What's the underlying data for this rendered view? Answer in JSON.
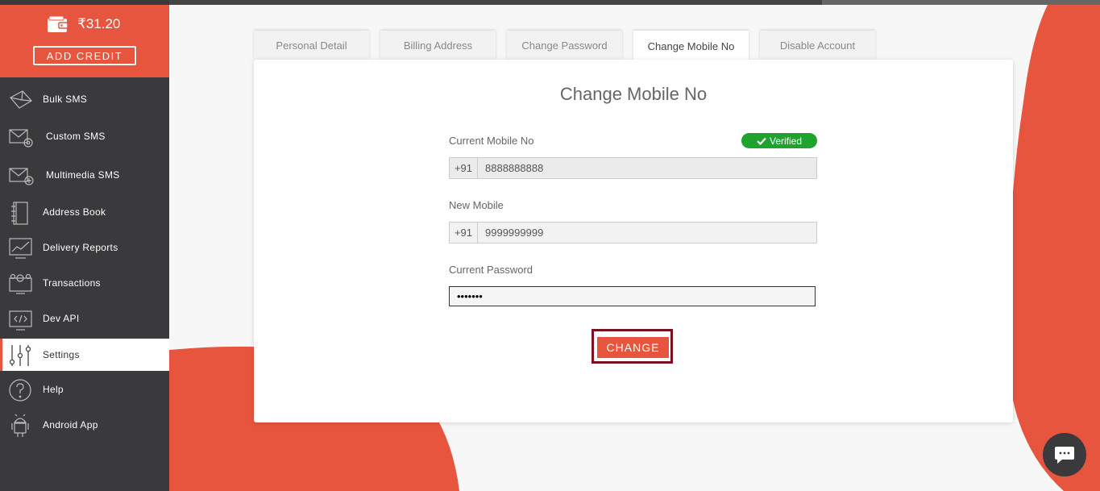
{
  "wallet": {
    "balance": "₹31.20",
    "add_credit_label": "ADD CREDIT"
  },
  "sidebar": {
    "items": [
      {
        "label": "Bulk SMS",
        "icon": "envelope-icon"
      },
      {
        "label": "Custom SMS",
        "icon": "envelope-gear-icon"
      },
      {
        "label": "Multimedia SMS",
        "icon": "envelope-plus-icon"
      },
      {
        "label": "Address Book",
        "icon": "address-book-icon"
      },
      {
        "label": "Delivery Reports",
        "icon": "chart-icon"
      },
      {
        "label": "Transactions",
        "icon": "transactions-icon"
      },
      {
        "label": "Dev API",
        "icon": "code-icon"
      },
      {
        "label": "Settings",
        "icon": "sliders-icon",
        "active": true
      },
      {
        "label": "Help",
        "icon": "question-icon"
      },
      {
        "label": "Android App",
        "icon": "android-icon"
      }
    ]
  },
  "tabs": [
    {
      "label": "Personal Detail"
    },
    {
      "label": "Billing Address"
    },
    {
      "label": "Change Password"
    },
    {
      "label": "Change Mobile No",
      "active": true
    },
    {
      "label": "Disable Account"
    }
  ],
  "form": {
    "title": "Change Mobile No",
    "current_mobile_label": "Current Mobile No",
    "verified_label": "Verified",
    "current_prefix": "+91",
    "current_mobile_value": "8888888888",
    "new_mobile_label": "New Mobile",
    "new_prefix": "+91",
    "new_mobile_value": "9999999999",
    "password_label": "Current Password",
    "password_value": "•••••••",
    "change_button": "CHANGE"
  },
  "colors": {
    "accent": "#e8553f",
    "sidebar": "#3a3a3c",
    "verified": "#1fa22e",
    "highlight": "#7a1020"
  }
}
